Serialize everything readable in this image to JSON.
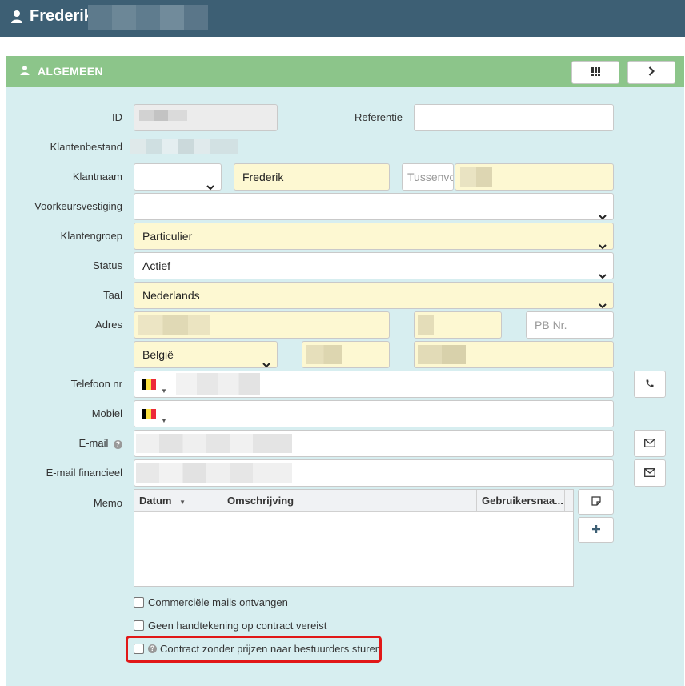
{
  "header": {
    "title": "Frederik",
    "user_icon": "user-icon"
  },
  "panel": {
    "title": "ALGEMEEN",
    "icons": {
      "grid": "grid-icon",
      "next": "chevron-right-icon"
    }
  },
  "labels": {
    "id": "ID",
    "referentie": "Referentie",
    "klantenbestand": "Klantenbestand",
    "klantnaam": "Klantnaam",
    "voorkeursvestiging": "Voorkeursvestiging",
    "klantengroep": "Klantengroep",
    "status": "Status",
    "taal": "Taal",
    "adres": "Adres",
    "telefoon": "Telefoon nr",
    "mobiel": "Mobiel",
    "email": "E-mail",
    "email_fin": "E-mail financieel",
    "memo": "Memo"
  },
  "fields": {
    "first_name": "Frederik",
    "tussenvoegsel_placeholder": "Tussenvoegsel",
    "klantengroep": "Particulier",
    "status": "Actief",
    "taal": "Nederlands",
    "pb_placeholder": "PB Nr.",
    "country": "België"
  },
  "memo": {
    "columns": [
      "Datum",
      "Omschrijving",
      "Gebruikersnaa..."
    ]
  },
  "checkboxes": {
    "commercial": "Commerciële mails ontvangen",
    "signature": "Geen handtekening op contract vereist",
    "contract": "Contract zonder prijzen naar bestuurders sturen"
  },
  "colors": {
    "topbar": "#3d5f74",
    "panel_header": "#8cc58a",
    "panel_bg": "#d7eef0",
    "required_field": "#fdf8d2",
    "highlight": "#e11818"
  }
}
